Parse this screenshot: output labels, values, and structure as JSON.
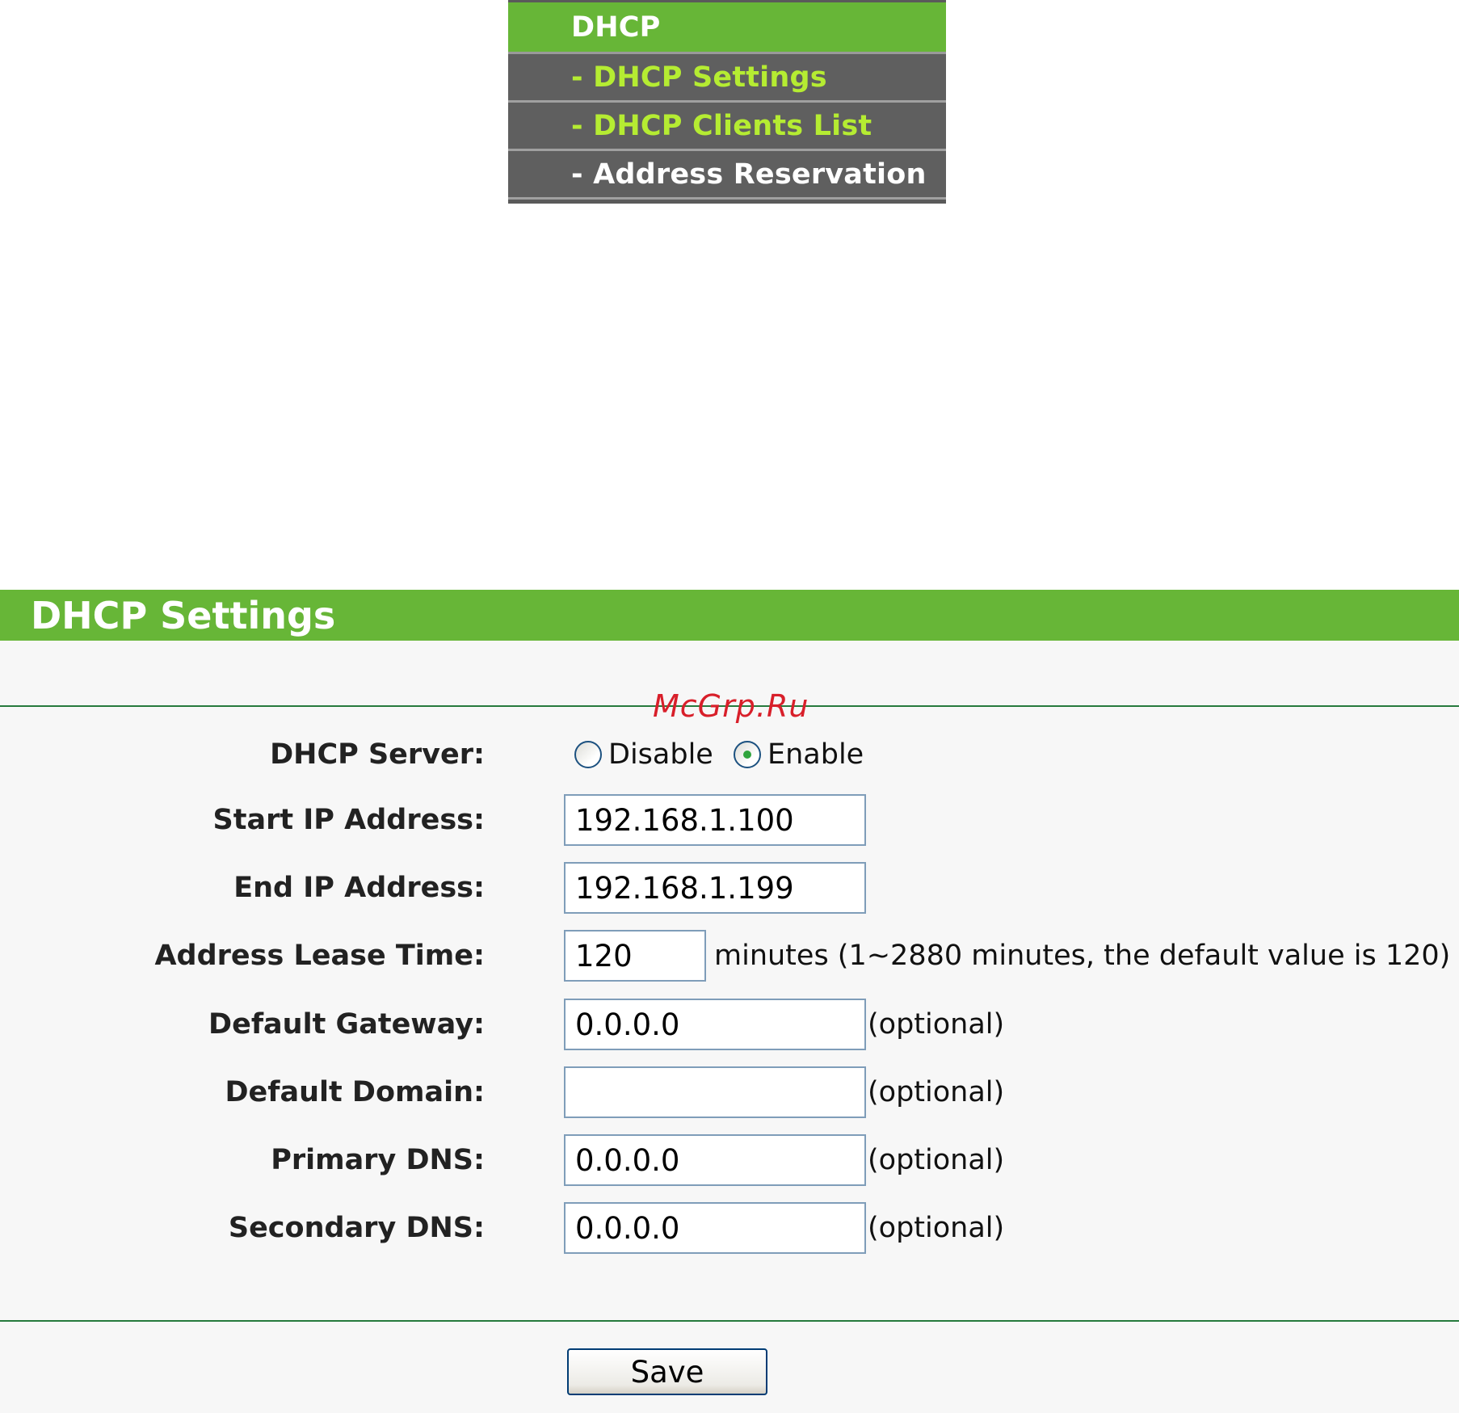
{
  "menu": {
    "header": "DHCP",
    "items": [
      {
        "label": "- DHCP Settings"
      },
      {
        "label": "- DHCP Clients List"
      },
      {
        "label": "- Address Reservation"
      }
    ]
  },
  "panel": {
    "title": "DHCP Settings"
  },
  "watermark": "McGrp.Ru",
  "form": {
    "dhcp_server": {
      "label": "DHCP Server:",
      "options": [
        "Disable",
        "Enable"
      ],
      "selected": "Enable"
    },
    "start_ip": {
      "label": "Start IP Address:",
      "value": "192.168.1.100"
    },
    "end_ip": {
      "label": "End IP Address:",
      "value": "192.168.1.199"
    },
    "lease_time": {
      "label": "Address Lease Time:",
      "value": "120",
      "hint": "minutes (1~2880 minutes, the default value is 120)"
    },
    "gateway": {
      "label": "Default Gateway:",
      "value": "0.0.0.0",
      "hint": "(optional)"
    },
    "domain": {
      "label": "Default Domain:",
      "value": "",
      "hint": "(optional)"
    },
    "primary_dns": {
      "label": "Primary DNS:",
      "value": "0.0.0.0",
      "hint": "(optional)"
    },
    "secondary_dns": {
      "label": "Secondary DNS:",
      "value": "0.0.0.0",
      "hint": "(optional)"
    }
  },
  "save_label": "Save",
  "colors": {
    "brand_green": "#67b637",
    "menu_gray": "#5f5f5f",
    "menu_link": "#b5ec32",
    "rule_green": "#267a3d",
    "watermark_red": "#d81f2a"
  }
}
